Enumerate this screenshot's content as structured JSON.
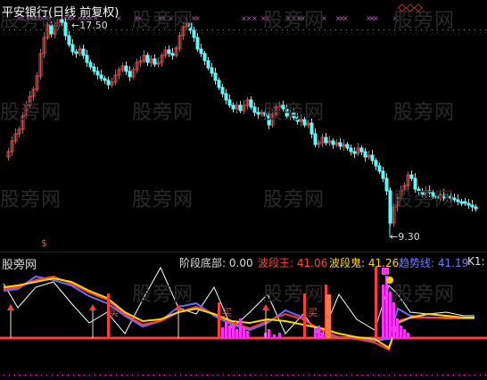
{
  "upper_panel": {
    "title": "平安银行(日线 前复权)",
    "high_label": "17.50",
    "low_label": "9.30"
  },
  "lower_panel": {
    "watermark_label": "股旁网",
    "indicator_name": "阶段底部:",
    "indicator_value": "0.00",
    "line1_name": "波段王:",
    "line1_value": "41.06",
    "line2_name": "波段鬼:",
    "line2_value": "41.26",
    "line3_name": "趋势线:",
    "line3_value": "41.19",
    "k_label": "K1:",
    "buy_marker": "买"
  },
  "watermark_text": "股旁网",
  "colors": {
    "bg": "#000000",
    "up_candle": "#ff3b3b",
    "down_candle": "#54ffff",
    "title": "#ffffff",
    "line1": "#ff3b3b",
    "line2": "#ff3b3b",
    "line3": "#6a6aff",
    "yellow": "#ffd700",
    "magenta": "#ff33ff",
    "white_line": "#ffffff",
    "x_marks": "#ff33ff"
  }
}
